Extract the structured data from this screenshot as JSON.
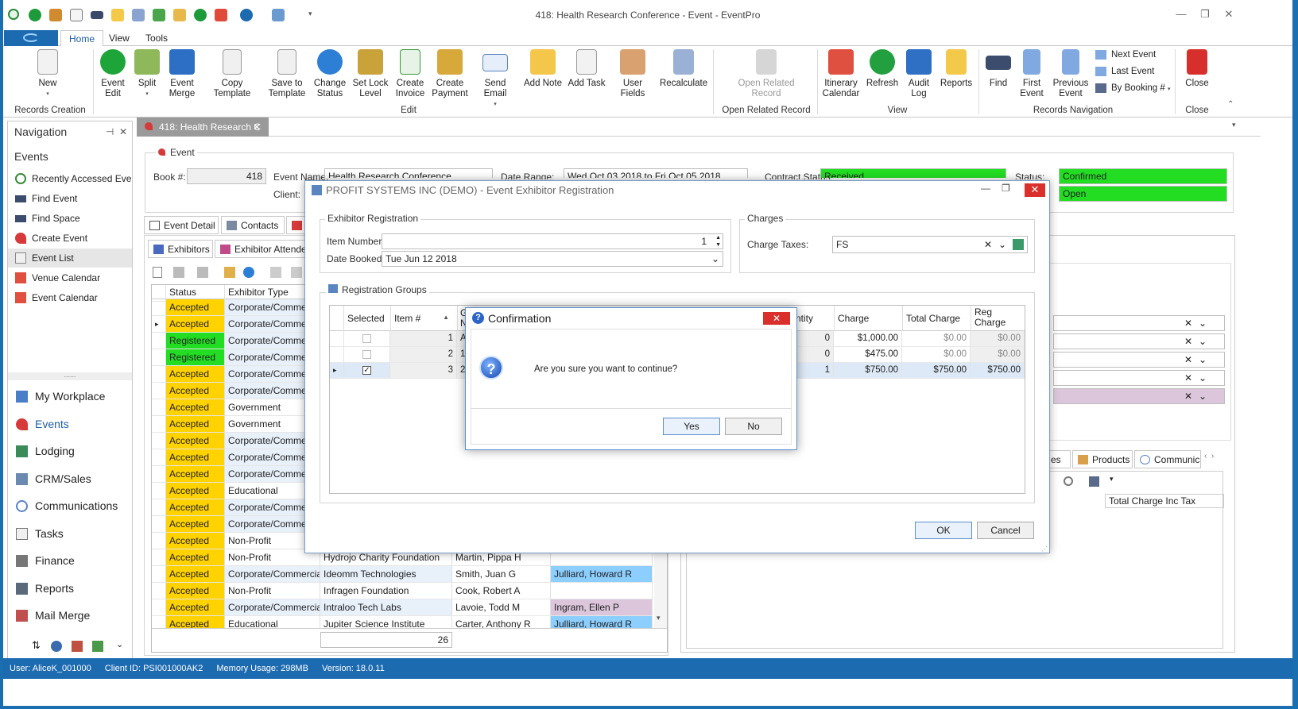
{
  "window": {
    "title": "418: Health Research Conference - Event - EventPro",
    "minimize": "—",
    "maximize": "❐",
    "close": "✕"
  },
  "ribbon_tabs": [
    "Home",
    "View",
    "Tools"
  ],
  "ribbon": {
    "new": "New",
    "event_edit": "Event\nEdit",
    "split": "Split",
    "event_merge": "Event\nMerge",
    "copy_template": "Copy Template",
    "save_to_template": "Save to\nTemplate",
    "change_status": "Change\nStatus",
    "set_lock_level": "Set Lock\nLevel",
    "create_invoice": "Create\nInvoice",
    "create_payment": "Create\nPayment",
    "send_email": "Send Email",
    "add_note": "Add Note",
    "add_task": "Add Task",
    "user_fields": "User Fields",
    "recalculate": "Recalculate",
    "open_related_record": "Open Related\nRecord",
    "itinerary_calendar": "Itinerary\nCalendar",
    "refresh": "Refresh",
    "audit_log": "Audit\nLog",
    "reports": "Reports",
    "find": "Find",
    "first_event": "First\nEvent",
    "previous_event": "Previous\nEvent",
    "next_event": "Next Event",
    "last_event": "Last Event",
    "by_booking": "By Booking #",
    "close": "Close",
    "groups": {
      "records_creation": "Records Creation",
      "edit": "Edit",
      "open_related_record": "Open Related Record",
      "view": "View",
      "records_navigation": "Records Navigation",
      "close": "Close"
    }
  },
  "navigation": {
    "title": "Navigation",
    "section": "Events",
    "items": [
      "Recently Accessed Eve...",
      "Find Event",
      "Find Space",
      "Create Event",
      "Event List",
      "Venue Calendar",
      "Event Calendar"
    ],
    "modules": [
      "My Workplace",
      "Events",
      "Lodging",
      "CRM/Sales",
      "Communications",
      "Tasks",
      "Finance",
      "Reports",
      "Mail Merge"
    ],
    "splitter": "......"
  },
  "doc_tab": "418: Health Research C",
  "event": {
    "group_title": "Event",
    "book_label": "Book #:",
    "book_value": "418",
    "name_label": "Event Name:",
    "name_value": "Health Research Conference",
    "date_label": "Date Range:",
    "date_value": "Wed Oct 03 2018 to Fri Oct 05 2018",
    "contract_label": "Contract Status:",
    "contract_value": "Received",
    "status_label": "Status:",
    "status_value": "Confirmed",
    "client_label": "Client:",
    "open_value": "Open",
    "status_colors": {
      "green": "#22dd22"
    }
  },
  "subtabs": [
    "Event Detail",
    "Contacts",
    "A"
  ],
  "inner_tabs": [
    "Exhibitors",
    "Exhibitor Attendees"
  ],
  "grid": {
    "headers": [
      "Status",
      "Exhibitor Type"
    ],
    "rows": [
      {
        "status": "Accepted",
        "type": "Corporate/Commercial",
        "org": "",
        "contact": "",
        "rep": ""
      },
      {
        "status": "Accepted",
        "type": "Corporate/Commercial",
        "org": "",
        "contact": "",
        "rep": ""
      },
      {
        "status": "Registered",
        "type": "Corporate/Commercial",
        "org": "",
        "contact": "",
        "rep": ""
      },
      {
        "status": "Registered",
        "type": "Corporate/Commercial",
        "org": "",
        "contact": "",
        "rep": ""
      },
      {
        "status": "Accepted",
        "type": "Corporate/Commercial",
        "org": "",
        "contact": "",
        "rep": ""
      },
      {
        "status": "Accepted",
        "type": "Corporate/Commercial",
        "org": "",
        "contact": "",
        "rep": ""
      },
      {
        "status": "Accepted",
        "type": "Government",
        "org": "",
        "contact": "",
        "rep": ""
      },
      {
        "status": "Accepted",
        "type": "Government",
        "org": "",
        "contact": "",
        "rep": ""
      },
      {
        "status": "Accepted",
        "type": "Corporate/Commercial",
        "org": "",
        "contact": "",
        "rep": ""
      },
      {
        "status": "Accepted",
        "type": "Corporate/Commercial",
        "org": "",
        "contact": "",
        "rep": ""
      },
      {
        "status": "Accepted",
        "type": "Corporate/Commercial",
        "org": "",
        "contact": "",
        "rep": ""
      },
      {
        "status": "Accepted",
        "type": "Educational",
        "org": "",
        "contact": "",
        "rep": ""
      },
      {
        "status": "Accepted",
        "type": "Corporate/Commercial",
        "org": "",
        "contact": "",
        "rep": ""
      },
      {
        "status": "Accepted",
        "type": "Corporate/Commercial",
        "org": "",
        "contact": "",
        "rep": ""
      },
      {
        "status": "Accepted",
        "type": "Non-Profit",
        "org": "",
        "contact": "",
        "rep": ""
      },
      {
        "status": "Accepted",
        "type": "Non-Profit",
        "org": "Hydrojo Charity Foundation",
        "contact": "Martin, Pippa H",
        "rep": ""
      },
      {
        "status": "Accepted",
        "type": "Corporate/Commercial",
        "org": "Ideomm Technologies",
        "contact": "Smith, Juan G",
        "rep": "Julliard, Howard R"
      },
      {
        "status": "Accepted",
        "type": "Non-Profit",
        "org": "Infragen Foundation",
        "contact": "Cook, Robert A",
        "rep": ""
      },
      {
        "status": "Accepted",
        "type": "Corporate/Commercial",
        "org": "Intraloo Tech Labs",
        "contact": "Lavoie, Todd M",
        "rep": "Ingram, Ellen P"
      },
      {
        "status": "Accepted",
        "type": "Educational",
        "org": "Jupiter Science Institute",
        "contact": "Carter, Anthony R",
        "rep": "Julliard, Howard R"
      }
    ],
    "footer_count": "26"
  },
  "right_panel": {
    "tabs": [
      "es",
      "Products",
      "Communicati"
    ],
    "column": "Total Charge Inc Tax"
  },
  "dialog": {
    "title": "PROFIT SYSTEMS INC (DEMO) - Event Exhibitor Registration",
    "exhibitor_group": "Exhibitor Registration",
    "item_number_label": "Item Number:",
    "item_number_value": "1",
    "date_booked_label": "Date Booked:",
    "date_booked_value": "Tue Jun 12 2018",
    "charges_group": "Charges",
    "charge_taxes_label": "Charge Taxes:",
    "charge_taxes_value": "FS",
    "registration_groups": "Registration Groups",
    "reg_headers": {
      "selected": "Selected",
      "item": "Item #",
      "g": "G\nN",
      "quantity": "ntity",
      "charge": "Charge",
      "total_charge": "Total Charge",
      "reg_charge": "Reg\nCharge"
    },
    "reg_rows": [
      {
        "item": "1",
        "g": "A",
        "qty": "0",
        "charge": "$1,000.00",
        "total": "$0.00",
        "reg": "$0.00",
        "checked": false
      },
      {
        "item": "2",
        "g": "1",
        "qty": "0",
        "charge": "$475.00",
        "total": "$0.00",
        "reg": "$0.00",
        "checked": false
      },
      {
        "item": "3",
        "g": "2",
        "qty": "1",
        "charge": "$750.00",
        "total": "$750.00",
        "reg": "$750.00",
        "checked": true
      }
    ],
    "ok": "OK",
    "cancel": "Cancel"
  },
  "confirm": {
    "title": "Confirmation",
    "message": "Are you sure you want to continue?",
    "yes": "Yes",
    "no": "No"
  },
  "statusbar": {
    "user": "User: AliceK_001000",
    "client": "Client ID: PSI001000AK2",
    "memory": "Memory Usage: 298MB",
    "version": "Version: 18.0.11"
  }
}
